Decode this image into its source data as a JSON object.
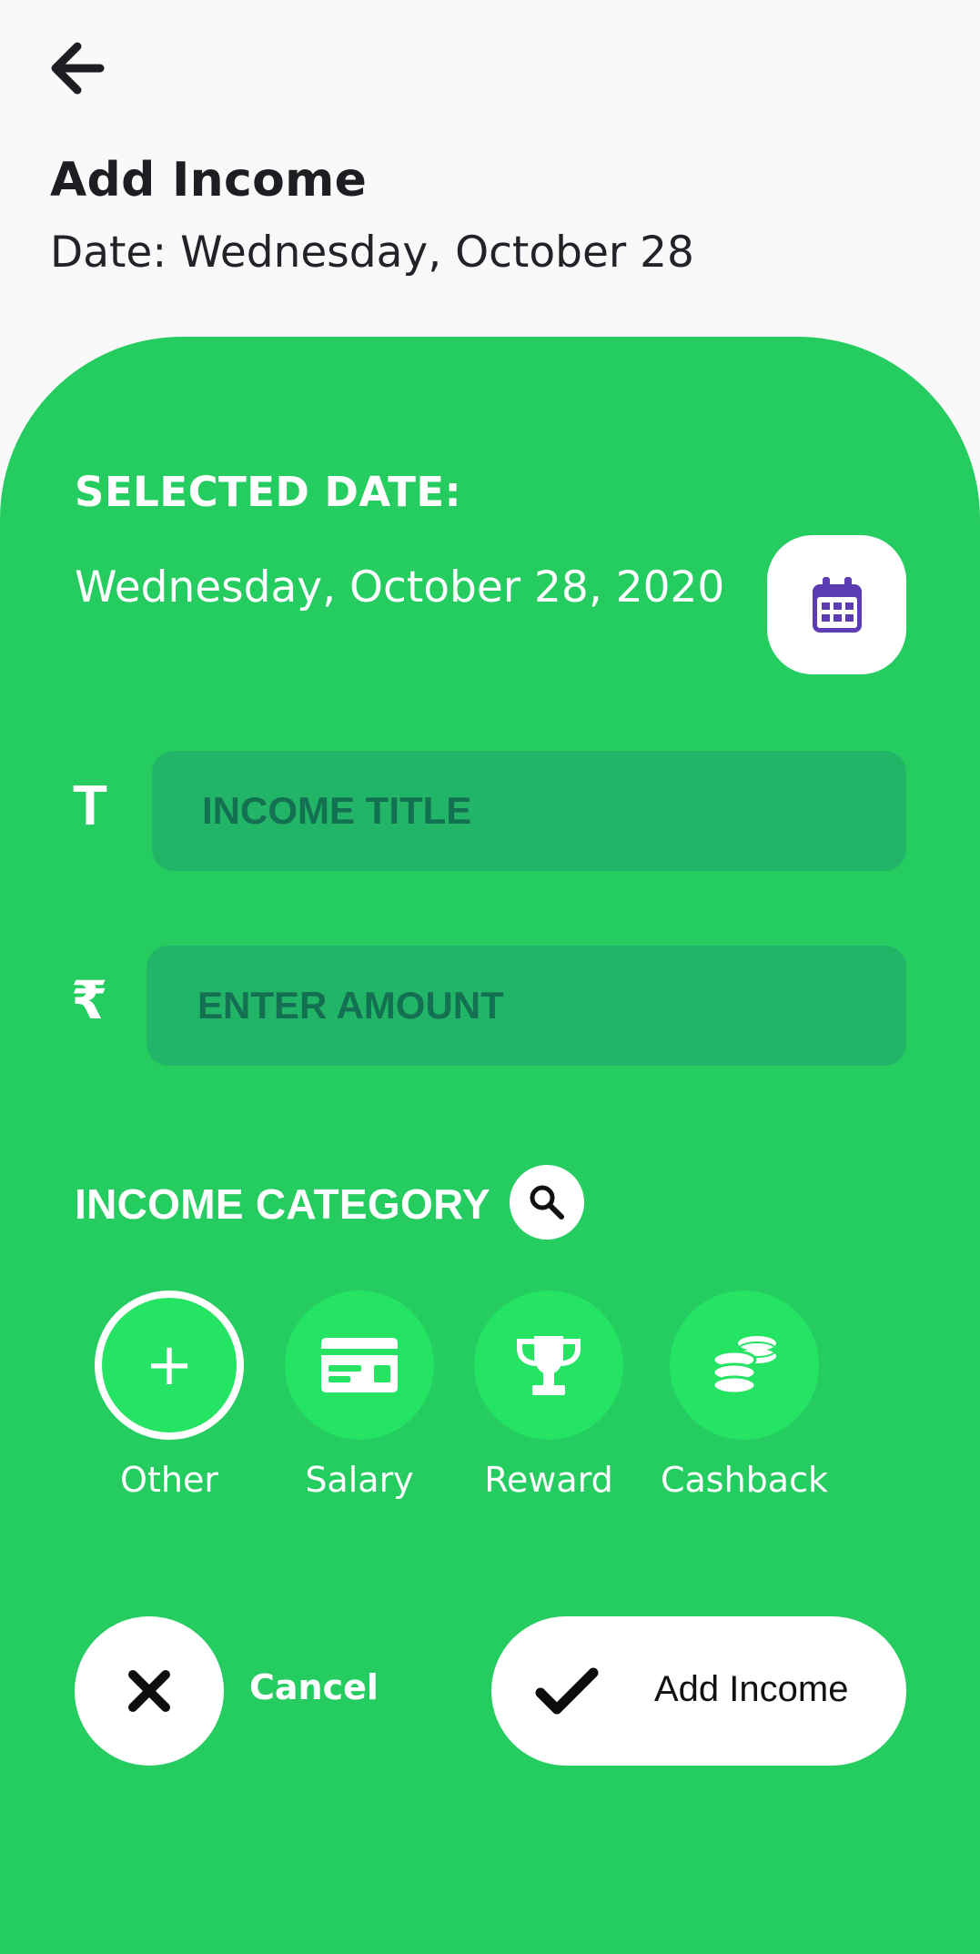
{
  "header": {
    "back_icon": "arrow-left-icon",
    "title": "Add Income",
    "subtitle": "Date: Wednesday, October 28"
  },
  "form": {
    "selected_date_label": "SELECTED DATE:",
    "selected_date_value": "Wednesday, October 28, 2020",
    "calendar_icon": "calendar-icon",
    "title_icon_glyph": "T",
    "title_placeholder": "INCOME TITLE",
    "title_value": "",
    "amount_icon_glyph": "₹",
    "amount_placeholder": "ENTER AMOUNT",
    "amount_value": ""
  },
  "category": {
    "label": "INCOME CATEGORY",
    "search_icon": "search-icon",
    "items": [
      {
        "name": "Other",
        "icon": "plus-icon",
        "selected": true
      },
      {
        "name": "Salary",
        "icon": "salary-card-icon",
        "selected": false
      },
      {
        "name": "Reward",
        "icon": "trophy-icon",
        "selected": false
      },
      {
        "name": "Cashback",
        "icon": "coins-icon",
        "selected": false
      }
    ]
  },
  "actions": {
    "cancel_icon": "close-icon",
    "cancel_label": "Cancel",
    "add_icon": "check-icon",
    "add_label": "Add Income"
  },
  "colors": {
    "panel_background": "#25cd61",
    "field_background": "#22b567",
    "field_placeholder": "#147052",
    "category_circle": "#25e363",
    "calendar_accent": "#5b3cb2",
    "page_background": "#f9f9fa"
  }
}
